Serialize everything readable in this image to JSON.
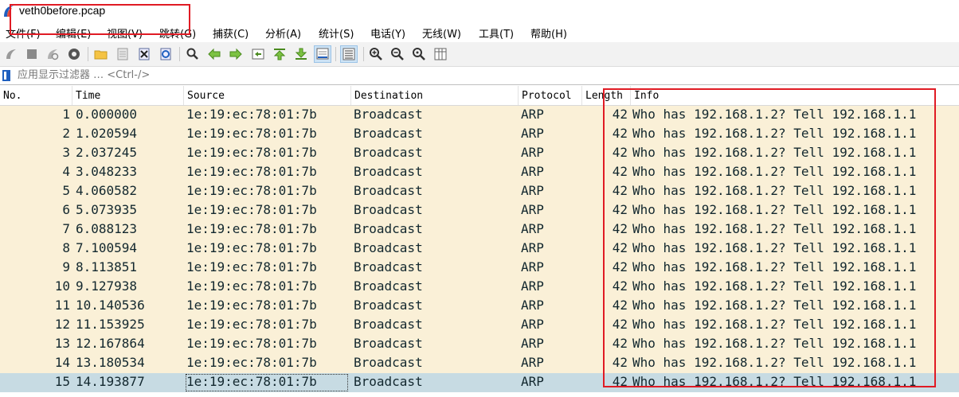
{
  "window": {
    "title": "veth0before.pcap"
  },
  "menu": [
    "文件(F)",
    "编辑(E)",
    "视图(V)",
    "跳转(G)",
    "捕获(C)",
    "分析(A)",
    "统计(S)",
    "电话(Y)",
    "无线(W)",
    "工具(T)",
    "帮助(H)"
  ],
  "toolbar": {
    "icons": [
      "start-capture",
      "stop-capture",
      "restart-capture",
      "capture-options",
      "open-file",
      "save-file",
      "close-file",
      "reload-file",
      "find-packet",
      "go-back",
      "go-forward",
      "go-to-packet",
      "first-packet",
      "last-packet",
      "auto-scroll",
      "colorize",
      "zoom-in",
      "zoom-out",
      "zoom-normal",
      "resize-columns"
    ]
  },
  "filter": {
    "placeholder": "应用显示过滤器 … <Ctrl-/>"
  },
  "columns": [
    "No.",
    "Time",
    "Source",
    "Destination",
    "Protocol",
    "Length",
    "Info"
  ],
  "packets": [
    {
      "no": "1",
      "time": "0.000000",
      "src": "1e:19:ec:78:01:7b",
      "dst": "Broadcast",
      "proto": "ARP",
      "len": "42",
      "info": "Who has 192.168.1.2? Tell 192.168.1.1"
    },
    {
      "no": "2",
      "time": "1.020594",
      "src": "1e:19:ec:78:01:7b",
      "dst": "Broadcast",
      "proto": "ARP",
      "len": "42",
      "info": "Who has 192.168.1.2? Tell 192.168.1.1"
    },
    {
      "no": "3",
      "time": "2.037245",
      "src": "1e:19:ec:78:01:7b",
      "dst": "Broadcast",
      "proto": "ARP",
      "len": "42",
      "info": "Who has 192.168.1.2? Tell 192.168.1.1"
    },
    {
      "no": "4",
      "time": "3.048233",
      "src": "1e:19:ec:78:01:7b",
      "dst": "Broadcast",
      "proto": "ARP",
      "len": "42",
      "info": "Who has 192.168.1.2? Tell 192.168.1.1"
    },
    {
      "no": "5",
      "time": "4.060582",
      "src": "1e:19:ec:78:01:7b",
      "dst": "Broadcast",
      "proto": "ARP",
      "len": "42",
      "info": "Who has 192.168.1.2? Tell 192.168.1.1"
    },
    {
      "no": "6",
      "time": "5.073935",
      "src": "1e:19:ec:78:01:7b",
      "dst": "Broadcast",
      "proto": "ARP",
      "len": "42",
      "info": "Who has 192.168.1.2? Tell 192.168.1.1"
    },
    {
      "no": "7",
      "time": "6.088123",
      "src": "1e:19:ec:78:01:7b",
      "dst": "Broadcast",
      "proto": "ARP",
      "len": "42",
      "info": "Who has 192.168.1.2? Tell 192.168.1.1"
    },
    {
      "no": "8",
      "time": "7.100594",
      "src": "1e:19:ec:78:01:7b",
      "dst": "Broadcast",
      "proto": "ARP",
      "len": "42",
      "info": "Who has 192.168.1.2? Tell 192.168.1.1"
    },
    {
      "no": "9",
      "time": "8.113851",
      "src": "1e:19:ec:78:01:7b",
      "dst": "Broadcast",
      "proto": "ARP",
      "len": "42",
      "info": "Who has 192.168.1.2? Tell 192.168.1.1"
    },
    {
      "no": "10",
      "time": "9.127938",
      "src": "1e:19:ec:78:01:7b",
      "dst": "Broadcast",
      "proto": "ARP",
      "len": "42",
      "info": "Who has 192.168.1.2? Tell 192.168.1.1"
    },
    {
      "no": "11",
      "time": "10.140536",
      "src": "1e:19:ec:78:01:7b",
      "dst": "Broadcast",
      "proto": "ARP",
      "len": "42",
      "info": "Who has 192.168.1.2? Tell 192.168.1.1"
    },
    {
      "no": "12",
      "time": "11.153925",
      "src": "1e:19:ec:78:01:7b",
      "dst": "Broadcast",
      "proto": "ARP",
      "len": "42",
      "info": "Who has 192.168.1.2? Tell 192.168.1.1"
    },
    {
      "no": "13",
      "time": "12.167864",
      "src": "1e:19:ec:78:01:7b",
      "dst": "Broadcast",
      "proto": "ARP",
      "len": "42",
      "info": "Who has 192.168.1.2? Tell 192.168.1.1"
    },
    {
      "no": "14",
      "time": "13.180534",
      "src": "1e:19:ec:78:01:7b",
      "dst": "Broadcast",
      "proto": "ARP",
      "len": "42",
      "info": "Who has 192.168.1.2? Tell 192.168.1.1"
    },
    {
      "no": "15",
      "time": "14.193877",
      "src": "1e:19:ec:78:01:7b",
      "dst": "Broadcast",
      "proto": "ARP",
      "len": "42",
      "info": "Who has 192.168.1.2? Tell 192.168.1.1"
    }
  ],
  "selected_packet": "15",
  "colors": {
    "row_bg": "#faf0d7",
    "selected_row_bg": "#c7dbe3",
    "row_text": "#12272e",
    "annotation": "#e01b24"
  }
}
